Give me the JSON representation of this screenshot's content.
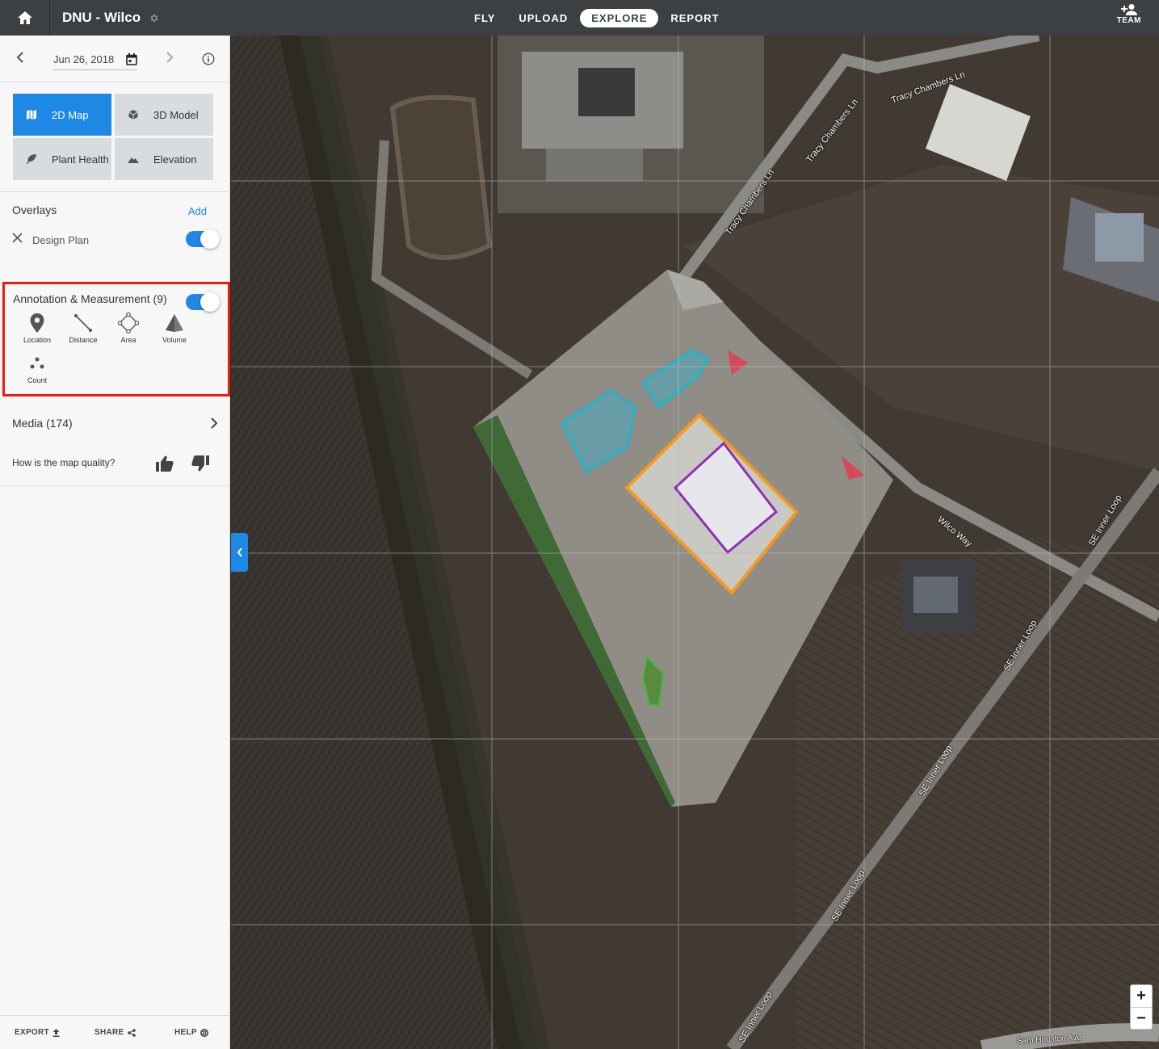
{
  "header": {
    "project_title": "DNU - Wilco",
    "nav": [
      "FLY",
      "UPLOAD",
      "EXPLORE",
      "REPORT"
    ],
    "active_nav": "EXPLORE",
    "team_label": "TEAM"
  },
  "sidebar": {
    "date": "Jun 26, 2018",
    "views": [
      {
        "label": "2D Map",
        "icon": "map-icon",
        "active": true
      },
      {
        "label": "3D Model",
        "icon": "cube-icon",
        "active": false
      },
      {
        "label": "Plant Health",
        "icon": "leaf-icon",
        "active": false
      },
      {
        "label": "Elevation",
        "icon": "mountain-icon",
        "active": false
      }
    ],
    "overlays": {
      "title": "Overlays",
      "add_label": "Add",
      "items": [
        {
          "label": "Design Plan",
          "enabled": true
        }
      ]
    },
    "annotation": {
      "title": "Annotation & Measurement (9)",
      "enabled": true,
      "tools": [
        {
          "label": "Location",
          "icon": "location-pin-icon"
        },
        {
          "label": "Distance",
          "icon": "distance-icon"
        },
        {
          "label": "Area",
          "icon": "area-icon"
        },
        {
          "label": "Volume",
          "icon": "volume-icon"
        },
        {
          "label": "Count",
          "icon": "count-icon"
        }
      ]
    },
    "media": {
      "label": "Media (174)"
    },
    "quality": {
      "label": "How is the map quality?"
    },
    "footer": {
      "export": "EXPORT",
      "share": "SHARE",
      "help": "HELP"
    }
  },
  "map": {
    "road_labels": [
      "Tracy Chambers Ln",
      "Tracy Chambers Ln",
      "Tracy Chambers Ln",
      "Wilco Way",
      "SE Inner Loop",
      "SE Inner Loop",
      "SE Inner Loop",
      "SE Inner Loop",
      "SE Inner Loop",
      "Sam Houston Ave"
    ],
    "zoom_in": "+",
    "zoom_out": "−"
  },
  "colors": {
    "accent": "#1e88e5",
    "highlight_border": "#ee1b0f",
    "topbar": "#3c4043"
  }
}
